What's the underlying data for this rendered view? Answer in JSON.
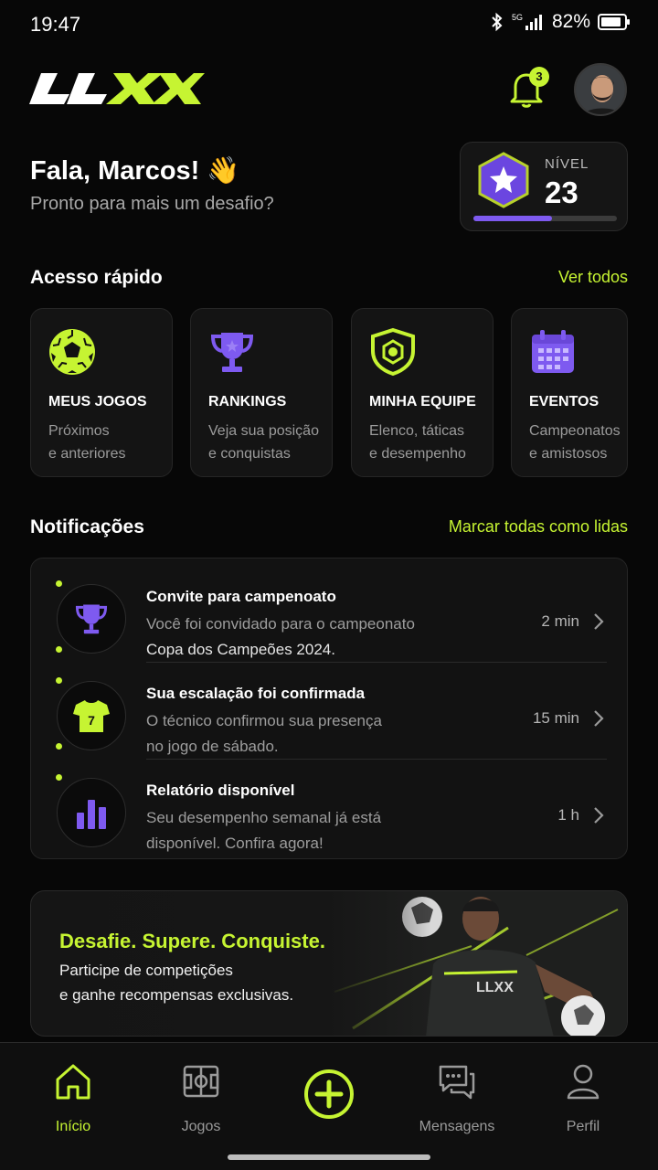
{
  "status": {
    "time": "19:47",
    "network": "5G",
    "battery": "82%"
  },
  "header": {
    "logo_text": "LLXX",
    "notifications_count": "3"
  },
  "greeting": {
    "title": "Fala, Marcos! 👋",
    "subtitle": "Pronto para mais um desafio?"
  },
  "level": {
    "label": "NÍVEL",
    "value": "23",
    "progress": 0.55
  },
  "quick_access": {
    "title": "Acesso rápido",
    "see_all": "Ver todos",
    "items": [
      {
        "title": "MEUS JOGOS",
        "line1": "Próximos",
        "line2": "e anteriores",
        "icon": "soccer-ball-icon"
      },
      {
        "title": "RANKINGS",
        "line1": "Veja sua posição",
        "line2": "e conquistas",
        "icon": "trophy-icon"
      },
      {
        "title": "MINHA EQUIPE",
        "line1": "Elenco, táticas",
        "line2": "e desempenho",
        "icon": "shield-icon"
      },
      {
        "title": "EVENTOS",
        "line1": "Campeonatos",
        "line2": "e amistosos",
        "icon": "calendar-icon"
      }
    ]
  },
  "notifications": {
    "title": "Notificações",
    "mark_all": "Marcar todas como lidas",
    "items": [
      {
        "title": "Convite para campenoato",
        "line1": "Você foi convidado para o campeonato",
        "line2": "Copa dos Campeões 2024.",
        "time": "2 min",
        "icon": "trophy-icon"
      },
      {
        "title": "Sua escalação foi confirmada",
        "line1": "O técnico confirmou sua presença",
        "line2": "no jogo de sábado.",
        "time": "15 min",
        "icon": "jersey-icon",
        "jersey_number": "7"
      },
      {
        "title": "Relatório disponível",
        "line1": "Seu desempenho semanal já está",
        "line2": "disponível. Confira agora!",
        "time": "1 h",
        "icon": "bar-chart-icon"
      }
    ]
  },
  "promo": {
    "title": "Desafie. Supere. Conquiste.",
    "line1": "Participe de competições",
    "line2": "e ganhe recompensas exclusivas."
  },
  "nav": {
    "items": [
      {
        "label": "Início",
        "icon": "home-icon",
        "active": true
      },
      {
        "label": "Jogos",
        "icon": "field-icon",
        "active": false
      },
      {
        "label": "",
        "icon": "add-circle-icon",
        "active": false
      },
      {
        "label": "Mensagens",
        "icon": "chat-icon",
        "active": false
      },
      {
        "label": "Perfil",
        "icon": "user-icon",
        "active": false
      }
    ]
  },
  "colors": {
    "accent": "#c6f432",
    "purple": "#7e5af0",
    "background": "#070707"
  }
}
